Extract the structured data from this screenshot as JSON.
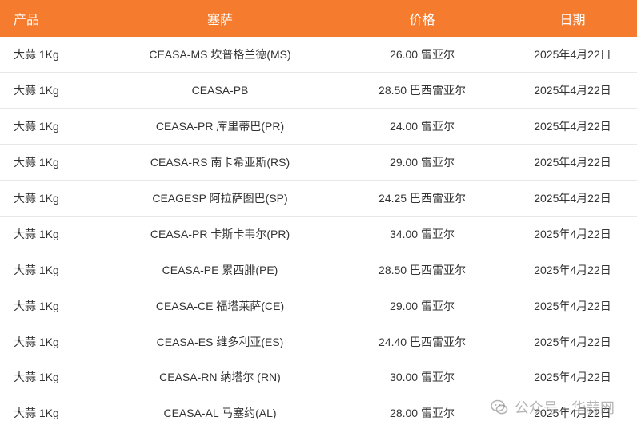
{
  "table": {
    "headers": {
      "product": "产品",
      "market": "塞萨",
      "price": "价格",
      "date": "日期"
    },
    "rows": [
      {
        "product": "大蒜 1Kg",
        "market": "CEASA-MS 坎普格兰德(MS)",
        "price": "26.00 雷亚尔",
        "date": "2025年4月22日"
      },
      {
        "product": "大蒜 1Kg",
        "market": "CEASA-PB",
        "price": "28.50 巴西雷亚尔",
        "date": "2025年4月22日"
      },
      {
        "product": "大蒜 1Kg",
        "market": "CEASA-PR 库里蒂巴(PR)",
        "price": "24.00 雷亚尔",
        "date": "2025年4月22日"
      },
      {
        "product": "大蒜 1Kg",
        "market": "CEASA-RS 南卡希亚斯(RS)",
        "price": "29.00 雷亚尔",
        "date": "2025年4月22日"
      },
      {
        "product": "大蒜 1Kg",
        "market": "CEAGESP 阿拉萨图巴(SP)",
        "price": "24.25 巴西雷亚尔",
        "date": "2025年4月22日"
      },
      {
        "product": "大蒜 1Kg",
        "market": "CEASA-PR 卡斯卡韦尔(PR)",
        "price": "34.00 雷亚尔",
        "date": "2025年4月22日"
      },
      {
        "product": "大蒜 1Kg",
        "market": "CEASA-PE 累西腓(PE)",
        "price": "28.50 巴西雷亚尔",
        "date": "2025年4月22日"
      },
      {
        "product": "大蒜 1Kg",
        "market": "CEASA-CE 福塔莱萨(CE)",
        "price": "29.00 雷亚尔",
        "date": "2025年4月22日"
      },
      {
        "product": "大蒜 1Kg",
        "market": "CEASA-ES 维多利亚(ES)",
        "price": "24.40 巴西雷亚尔",
        "date": "2025年4月22日"
      },
      {
        "product": "大蒜 1Kg",
        "market": "CEASA-RN 纳塔尔 (RN)",
        "price": "30.00 雷亚尔",
        "date": "2025年4月22日"
      },
      {
        "product": "大蒜 1Kg",
        "market": "CEASA-AL 马塞约(AL)",
        "price": "28.00 雷亚尔",
        "date": "2025年4月22日"
      }
    ]
  },
  "watermark": {
    "text": "公众号 · 华蒜网",
    "icon": "wechat-icon"
  },
  "colors": {
    "header_bg": "#f57c2e",
    "header_text": "#ffffff",
    "row_border": "#e8e8e8"
  }
}
